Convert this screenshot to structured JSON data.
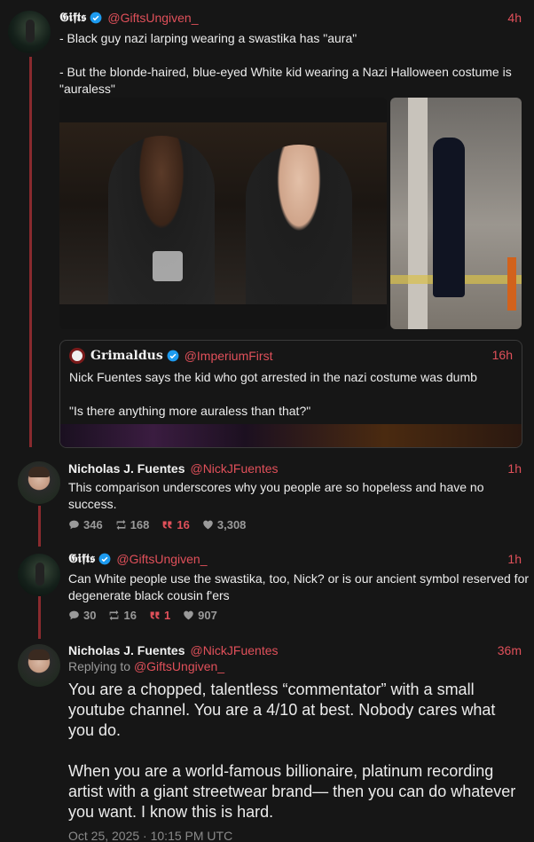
{
  "tweets": {
    "t1": {
      "name": "𝕲𝖎𝖋𝖙𝖘",
      "handle": "@GiftsUngiven_",
      "time": "4h",
      "text": "- Black guy nazi larping wearing a swastika has \"aura\"\n\n- But the blonde-haired, blue-eyed White kid wearing a Nazi Halloween costume is \"auraless\""
    },
    "quote": {
      "name": "Grimaldus",
      "handle": "@ImperiumFirst",
      "time": "16h",
      "text": "Nick Fuentes says the kid who got arrested in the nazi costume was dumb\n\n\"Is there anything more auraless than that?\""
    },
    "t2": {
      "name": "Nicholas J. Fuentes",
      "handle": "@NickJFuentes",
      "time": "1h",
      "text": "This comparison underscores why you people are so hopeless and have no success.",
      "replies": "346",
      "retweets": "168",
      "quotes": "16",
      "likes": "3,308"
    },
    "t3": {
      "name": "𝕲𝖎𝖋𝖙𝖘",
      "handle": "@GiftsUngiven_",
      "time": "1h",
      "text": "Can White people use the swastika, too, Nick? or is our ancient symbol reserved for degenerate black cousin f'ers",
      "replies": "30",
      "retweets": "16",
      "quotes": "1",
      "likes": "907"
    },
    "t4": {
      "name": "Nicholas J. Fuentes",
      "handle": "@NickJFuentes",
      "time": "36m",
      "replying_prefix": "Replying to ",
      "replying_handle": "@GiftsUngiven_",
      "text": "You are a chopped, talentless “commentator” with a small youtube channel. You are a 4/10 at best. Nobody cares what you do.\n\nWhen you are a world-famous billionaire, platinum recording artist with a giant streetwear brand— then you can do whatever you want. I know this is hard.",
      "timestamp": "Oct 25, 2025 · 10:15 PM UTC"
    }
  },
  "colors": {
    "accent": "#e0505a",
    "thread_line": "#8a2a2e",
    "verified": "#1d9bf0",
    "background": "#161616"
  },
  "icons": [
    "verified-icon",
    "reply-icon",
    "retweet-icon",
    "quote-icon",
    "heart-icon"
  ]
}
